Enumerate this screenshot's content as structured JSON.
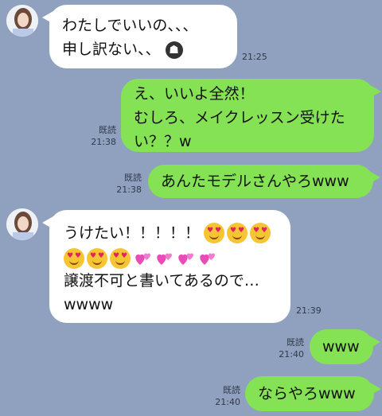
{
  "messages": [
    {
      "side": "left",
      "lines": [
        "わたしでいいの、、、",
        "申し訳ない、、"
      ],
      "badge_icon": "ghost-emoji-icon",
      "time": "21:25"
    },
    {
      "side": "right",
      "lines": [
        "え、いいよ全然！",
        "むしろ、メイクレッスン受けた",
        "い？？w"
      ],
      "read": "既読",
      "time": "21:38"
    },
    {
      "side": "right",
      "lines": [
        "あんたモデルさんやろwww"
      ],
      "read": "既読",
      "time": "21:38"
    },
    {
      "side": "left",
      "lines": [
        "うけたい！！！！！",
        "譲渡不可と書いてあるので…",
        "wwww"
      ],
      "emoji": [
        "heart-eyes-emoji-icon",
        "heart-eyes-emoji-icon",
        "heart-eyes-emoji-icon",
        "heart-eyes-emoji-icon",
        "heart-eyes-emoji-icon",
        "heart-eyes-emoji-icon",
        "two-hearts-emoji-icon",
        "two-hearts-emoji-icon",
        "two-hearts-emoji-icon",
        "two-hearts-emoji-icon"
      ],
      "time": "21:39"
    },
    {
      "side": "right",
      "lines": [
        "www"
      ],
      "read": "既読",
      "time": "21:40"
    },
    {
      "side": "right",
      "lines": [
        "ならやろwww"
      ],
      "read": "既読",
      "time": "21:40"
    }
  ],
  "colors": {
    "background": "#8fa1bf",
    "incoming_bubble": "#ffffff",
    "outgoing_bubble": "#84e254"
  }
}
